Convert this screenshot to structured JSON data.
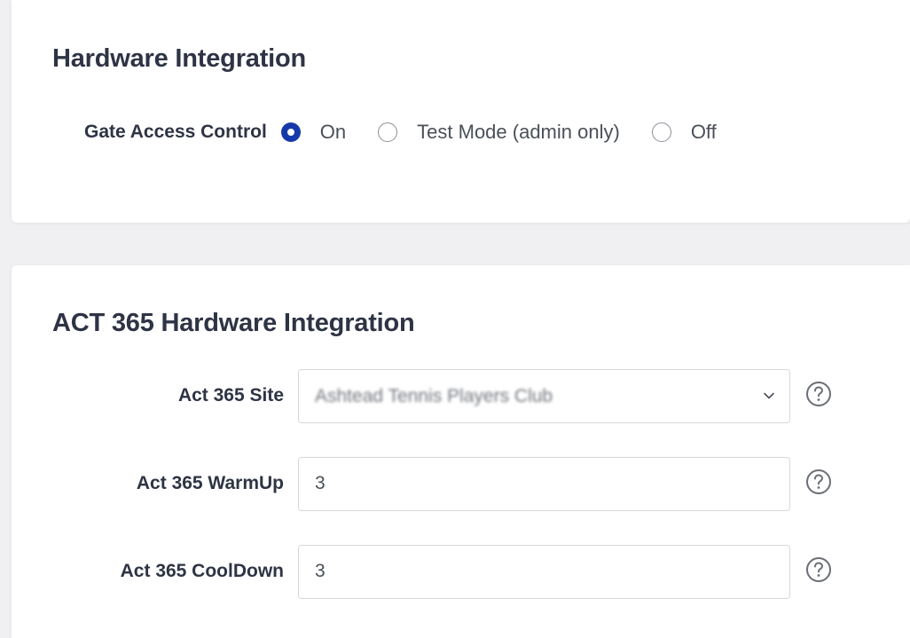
{
  "hardware_integration": {
    "title": "Hardware Integration",
    "gate_access_control": {
      "label": "Gate Access Control",
      "options": [
        "On",
        "Test Mode (admin only)",
        "Off"
      ],
      "selected": "On"
    }
  },
  "act365": {
    "title": "ACT 365 Hardware Integration",
    "site": {
      "label": "Act 365 Site",
      "value": "Ashtead Tennis Players Club",
      "icon": "chevron-down-icon",
      "help_icon": "help-icon"
    },
    "warmup": {
      "label": "Act 365 WarmUp",
      "value": "3",
      "help_icon": "help-icon"
    },
    "cooldown": {
      "label": "Act 365 CoolDown",
      "value": "3",
      "help_icon": "help-icon"
    }
  },
  "colors": {
    "accent": "#1539a8",
    "page_bg": "#f0f0f2",
    "card_bg": "#ffffff",
    "heading": "#2e3445",
    "border": "#d6d8dc"
  }
}
